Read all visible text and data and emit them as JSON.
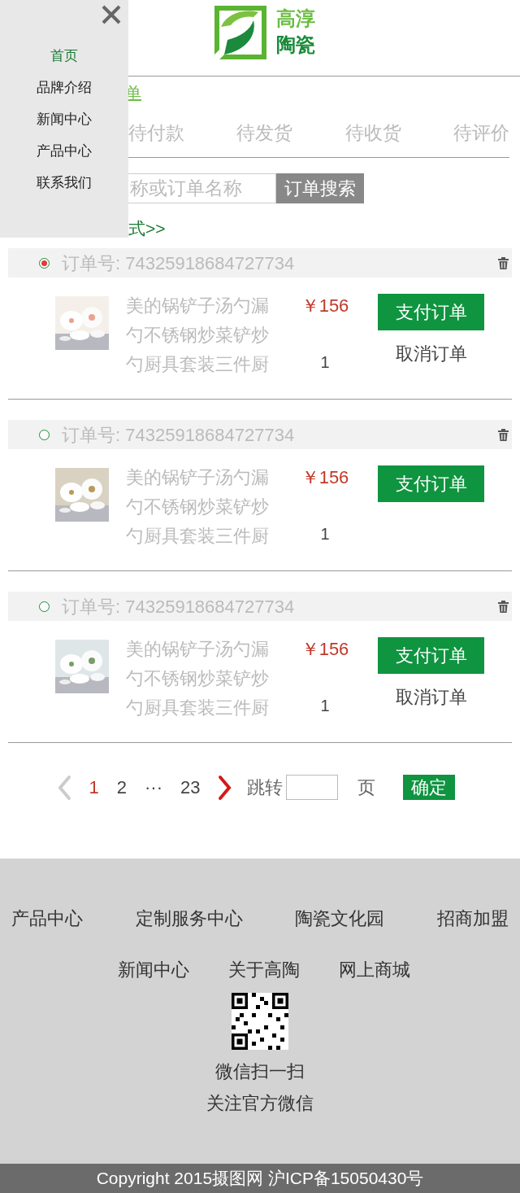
{
  "nav_drawer": {
    "items": [
      {
        "label": "首页",
        "selected": true
      },
      {
        "label": "品牌介绍",
        "selected": false
      },
      {
        "label": "新闻中心",
        "selected": false
      },
      {
        "label": "产品中心",
        "selected": false
      },
      {
        "label": "联系我们",
        "selected": false
      }
    ]
  },
  "logo": {
    "lines": [
      "高淳",
      "陶瓷"
    ]
  },
  "top_link": "单",
  "tabs": [
    {
      "label": "待付款",
      "selected": false
    },
    {
      "label": "待发货",
      "selected": false
    },
    {
      "label": "待收货",
      "selected": false
    },
    {
      "label": "待评价",
      "selected": false
    }
  ],
  "search": {
    "placeholder": "称或订单名称",
    "button": "订单搜索"
  },
  "bottom_link": "式>>",
  "orders": [
    {
      "selected": true,
      "order_no": "订单号: 74325918684727734",
      "title": "美的锅铲子汤勺漏勺不锈钢炒菜铲炒勺厨具套装三件厨",
      "price": "￥156",
      "quantity": "1",
      "pay_button": "支付订单",
      "cancel_button": "取消订单"
    },
    {
      "selected": false,
      "order_no": "订单号: 74325918684727734",
      "title": "美的锅铲子汤勺漏勺不锈钢炒菜铲炒勺厨具套装三件厨",
      "price": "￥156",
      "quantity": "1",
      "pay_button": "支付订单"
    },
    {
      "selected": false,
      "order_no": "订单号: 74325918684727734",
      "title": "美的锅铲子汤勺漏勺不锈钢炒菜铲炒勺厨具套装三件厨",
      "price": "￥156",
      "quantity": "1",
      "pay_button": "支付订单",
      "cancel_button": "取消订单"
    }
  ],
  "pagination": {
    "prev_disabled": true,
    "pages": [
      {
        "label": "1",
        "selected": true
      },
      {
        "label": "2",
        "selected": false
      },
      {
        "label": "···",
        "selected": false
      },
      {
        "label": "23",
        "selected": false
      }
    ],
    "next_disabled": false,
    "jump_label": "跳转",
    "page_unit": "页",
    "confirm": "确定"
  },
  "footer": {
    "link_rows": [
      [
        "产品中心",
        "定制服务中心",
        "陶瓷文化园",
        "招商加盟"
      ],
      [
        "新闻中心",
        "关于高陶",
        "网上商城"
      ]
    ],
    "qr_captions": [
      "微信扫一扫",
      "关注官方微信"
    ],
    "copyright": "Copyright 2015摄图网 沪ICP备15050430号"
  }
}
